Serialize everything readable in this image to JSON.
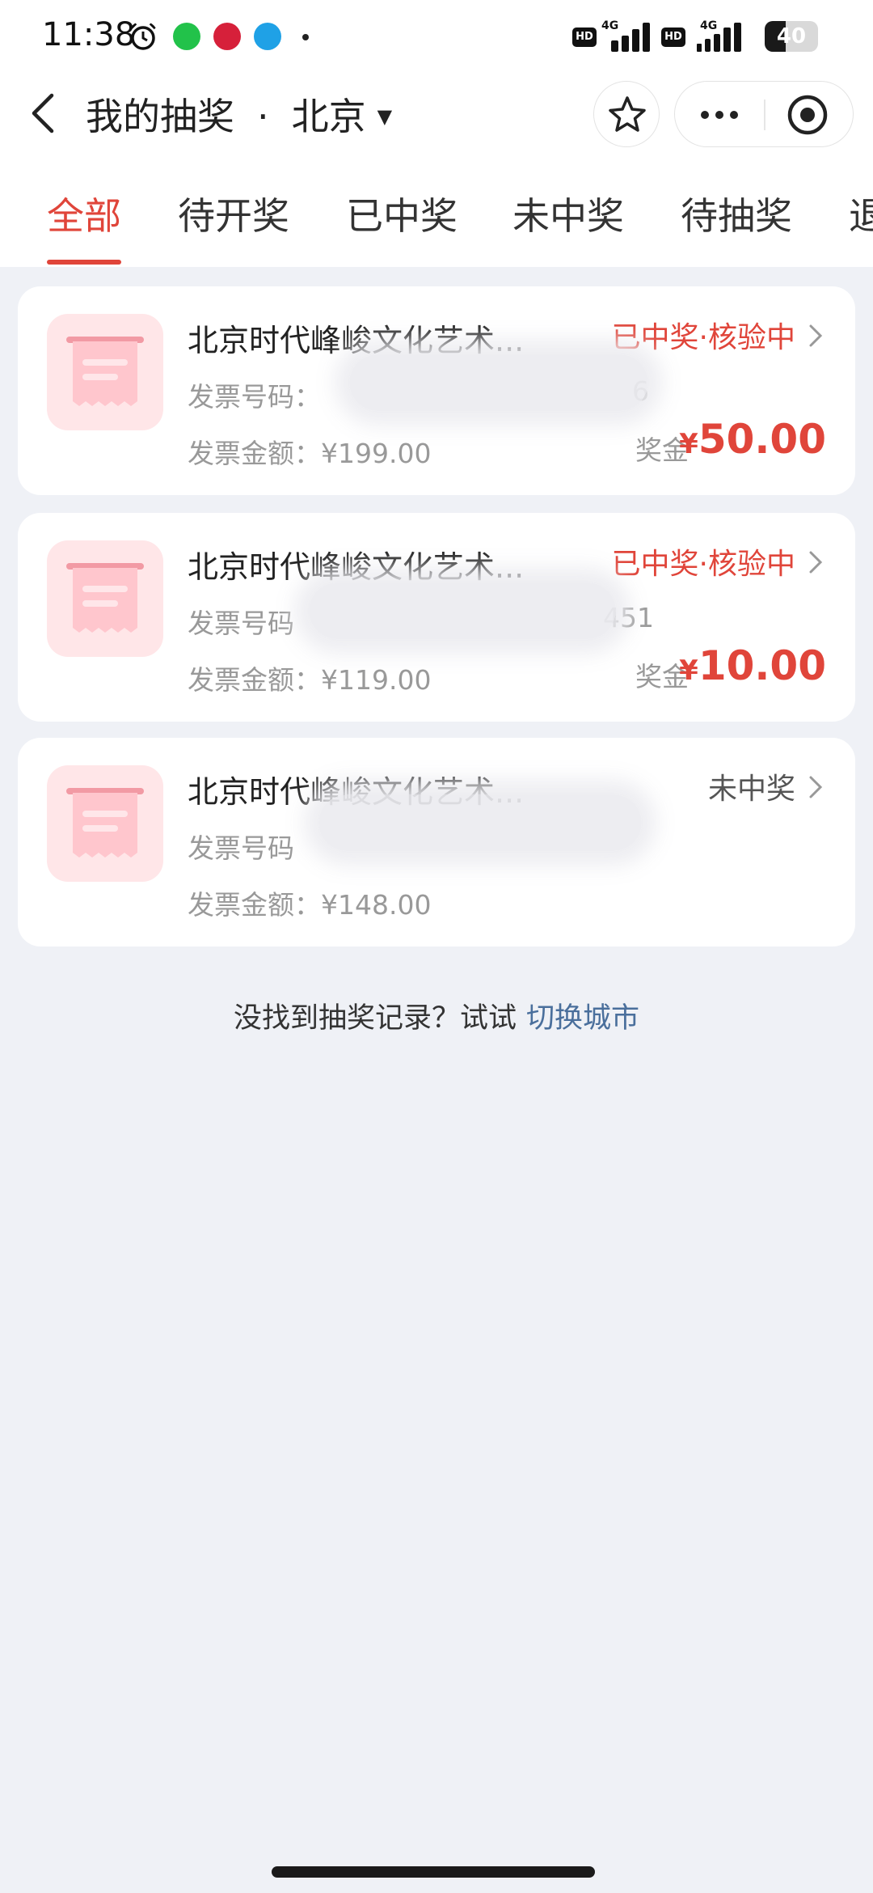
{
  "status_bar": {
    "time": "11:38",
    "network1_label": "4G",
    "network2_label": "4G",
    "hd_label": "HD",
    "battery": "40",
    "battery_level": 0.4
  },
  "nav": {
    "title": "我的抽奖",
    "separator": "·",
    "city": "北京",
    "city_dropdown_icon": "triangle-down-icon"
  },
  "tabs": [
    {
      "label": "全部",
      "active": true
    },
    {
      "label": "待开奖",
      "active": false
    },
    {
      "label": "已中奖",
      "active": false
    },
    {
      "label": "未中奖",
      "active": false
    },
    {
      "label": "待抽奖",
      "active": false
    },
    {
      "label": "退",
      "active": false
    }
  ],
  "records": [
    {
      "title": "北京时代峰峻文化艺术...",
      "status": "已中奖·核验中",
      "status_type": "win",
      "invoice_no_label": "发票号码：",
      "invoice_no_tail": "6",
      "amount_label": "发票金额：",
      "amount": "¥199.00",
      "prize_label": "奖金",
      "prize_currency": "¥",
      "prize_value": "50.00"
    },
    {
      "title": "北京时代峰峻文化艺术...",
      "status": "已中奖·核验中",
      "status_type": "win",
      "invoice_no_label": "发票号码",
      "invoice_no_tail": "451",
      "amount_label": "发票金额：",
      "amount": "¥119.00",
      "prize_label": "奖金",
      "prize_currency": "¥",
      "prize_value": "10.00"
    },
    {
      "title": "北京时代峰峻文化艺术...",
      "status": "未中奖",
      "status_type": "lose",
      "invoice_no_label": "发票号码",
      "invoice_no_tail": "",
      "amount_label": "发票金额：",
      "amount": "¥148.00",
      "prize_label": "",
      "prize_currency": "",
      "prize_value": ""
    }
  ],
  "footer": {
    "hint": "没找到抽奖记录？试试",
    "link": "切换城市"
  },
  "colors": {
    "accent": "#e0453a",
    "link": "#4a6f9c",
    "background": "#eff1f6"
  }
}
